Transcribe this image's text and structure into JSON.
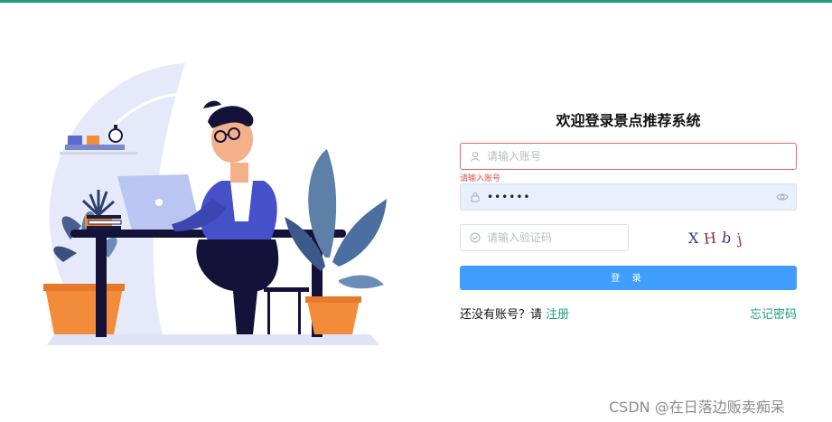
{
  "login": {
    "title": "欢迎登录景点推荐系统",
    "account_placeholder": "请输入账号",
    "account_error": "请输入账号",
    "password_value": "••••••",
    "captcha_placeholder": "请输入验证码",
    "captcha_chars": [
      "X",
      "H",
      "b",
      "j"
    ],
    "login_button": "登 录",
    "register_prompt": "还没有账号？请",
    "register_link": "注册",
    "forgot_link": "忘记密码"
  },
  "watermark": "CSDN @在日落边贩卖痴呆",
  "colors": {
    "accent_green": "#1e9e7a",
    "primary_blue": "#409eff",
    "error_red": "#e44c4c"
  },
  "icons": [
    "user-icon",
    "lock-icon",
    "eye-icon",
    "shield-check-icon",
    "laptop-icon",
    "plant-icon"
  ]
}
